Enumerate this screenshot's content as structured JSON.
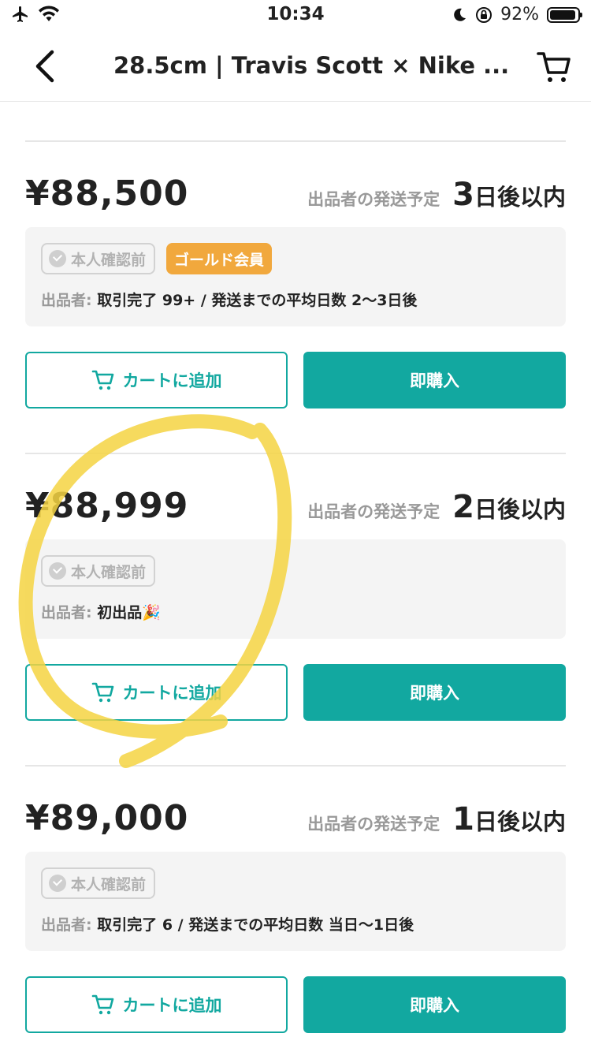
{
  "status_bar": {
    "time": "10:34",
    "battery": "92%"
  },
  "nav": {
    "title": "28.5cm | Travis Scott × Nike ..."
  },
  "listings": [
    {
      "price": "¥88,500",
      "ship_label": "出品者の発送予定",
      "ship_days": "3",
      "ship_unit": "日後以内",
      "verify_badge": "本人確認前",
      "gold_badge": "ゴールド会員",
      "seller_label": "出品者:",
      "seller_info": "取引完了 99+ / 発送までの平均日数 2〜3日後",
      "cart_label": "カートに追加",
      "buy_label": "即購入"
    },
    {
      "price": "¥88,999",
      "ship_label": "出品者の発送予定",
      "ship_days": "2",
      "ship_unit": "日後以内",
      "verify_badge": "本人確認前",
      "seller_label": "出品者:",
      "seller_info": "初出品🎉",
      "cart_label": "カートに追加",
      "buy_label": "即購入"
    },
    {
      "price": "¥89,000",
      "ship_label": "出品者の発送予定",
      "ship_days": "1",
      "ship_unit": "日後以内",
      "verify_badge": "本人確認前",
      "seller_label": "出品者:",
      "seller_info": "取引完了 6 / 発送までの平均日数 当日〜1日後",
      "cart_label": "カートに追加",
      "buy_label": "即購入"
    }
  ],
  "colors": {
    "accent": "#12a8a0",
    "gold": "#f1a83d",
    "highlight": "#f5d442"
  }
}
